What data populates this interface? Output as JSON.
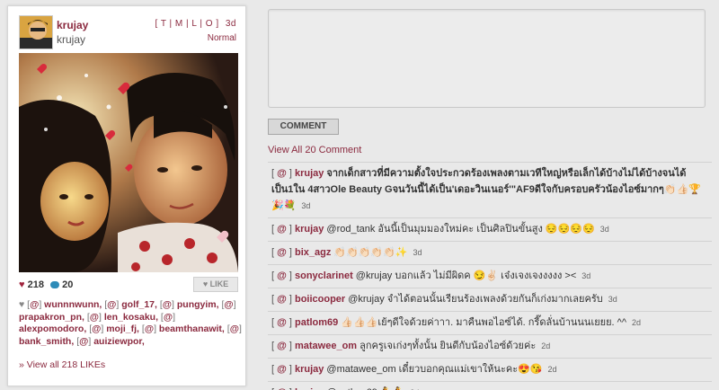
{
  "post": {
    "username": "krujay",
    "fullname": "krujay",
    "view_links": "[ T | M | L | O ]",
    "age": "3d",
    "filter": "Normal",
    "likes_count": "218",
    "comments_count": "20",
    "like_button": "LIKE",
    "likers": [
      "wunnnwunn",
      "golf_17",
      "pungyim",
      "prapakron_pn",
      "len_kosaku",
      "alexpomodoro",
      "moji_fj",
      "beamthanawit",
      "bank_smith",
      "auiziewpor"
    ],
    "view_all_likes": "» View all 218 LIKEs"
  },
  "composer": {
    "comment_button": "COMMENT",
    "view_all_comments": "View All 20 Comment"
  },
  "comments": [
    {
      "user": "krujay",
      "text": "จากเด็กสาวที่มีความตั้งใจประกวดร้องเพลงตามเวทีใหญ่หรือเล็กได้บ้างไม่ได้บ้างจนได้เป็น1ใน 4สาวOle Beauty Gจนวันนี้ได้เป็น'เดอะวินเนอร์'\"AF9ดีใจกับครอบครัวน้องไอซ์มากๆ👏🏻👍🏻🏆🎉💐",
      "ago": "3d",
      "bold": true
    },
    {
      "user": "krujay",
      "text": "@rod_tank อันนี้เป็นมุมมองใหม่คะ เป็นศิลปินขั้นสูง 😔😔😔😔",
      "ago": "3d",
      "bold": false
    },
    {
      "user": "bix_agz",
      "text": "👏🏻👏🏻👏🏻👏🏻👏🏻✨",
      "ago": "3d",
      "bold": false
    },
    {
      "user": "sonyclarinet",
      "text": "@krujay บอกแล้ว ไม่มีผิดค 😏✌🏻 เจ๋งเจงเจงงงงง ><",
      "ago": "3d",
      "bold": false
    },
    {
      "user": "boiicooper",
      "text": "@krujay จำได้ตอนนั้นเรียนร้องเพลงด้วยกันก็เก่งมากเลยครับ",
      "ago": "3d",
      "bold": false
    },
    {
      "user": "patlom69",
      "text": "👍🏻👍🏻👍🏻เย้ๆดีใจด้วยค่าาา. มาคืนพอไอซ์ได้. กรี๊ดลั่นบ้านนนเยยย. ^^",
      "ago": "2d",
      "bold": false
    },
    {
      "user": "matawee_om",
      "text": "ลูกครูเจเก่งๆทั้งนั้น ยินดีกับน้องไอซ์ด้วยค่ะ",
      "ago": "2d",
      "bold": false
    },
    {
      "user": "krujay",
      "text": "@matawee_om เดี๋ยวบอกคุณแม่เขาให้นะคะ😍😘",
      "ago": "2d",
      "bold": false
    },
    {
      "user": "krujay",
      "text": "@patlom69 💃💃",
      "ago": "2d",
      "bold": false
    }
  ],
  "ui": {
    "at_label": "@",
    "open_bracket": "[",
    "close_bracket": "]"
  },
  "colors": {
    "accent": "#8b2a3f",
    "page_bg": "#e9e9e9",
    "card_bg": "#ffffff"
  }
}
